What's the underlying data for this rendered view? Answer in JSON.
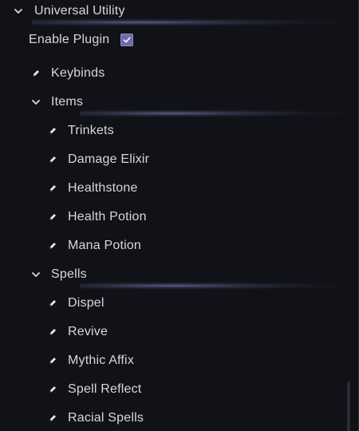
{
  "root": {
    "label": "Universal Utility"
  },
  "enable_plugin": {
    "label": "Enable Plugin",
    "checked": true
  },
  "keybinds": {
    "label": "Keybinds"
  },
  "items": {
    "label": "Items",
    "children": [
      "Trinkets",
      "Damage Elixir",
      "Healthstone",
      "Health Potion",
      "Mana Potion"
    ]
  },
  "spells": {
    "label": "Spells",
    "children": [
      "Dispel",
      "Revive",
      "Mythic Affix",
      "Spell Reflect",
      "Racial Spells"
    ]
  },
  "colors": {
    "background": "#111217",
    "accent": "#6d6ca8",
    "text": "#d7d7df"
  },
  "icons": {
    "collapse": "chevron-down-icon",
    "leaf": "pen-icon",
    "check": "checkmark-icon"
  }
}
